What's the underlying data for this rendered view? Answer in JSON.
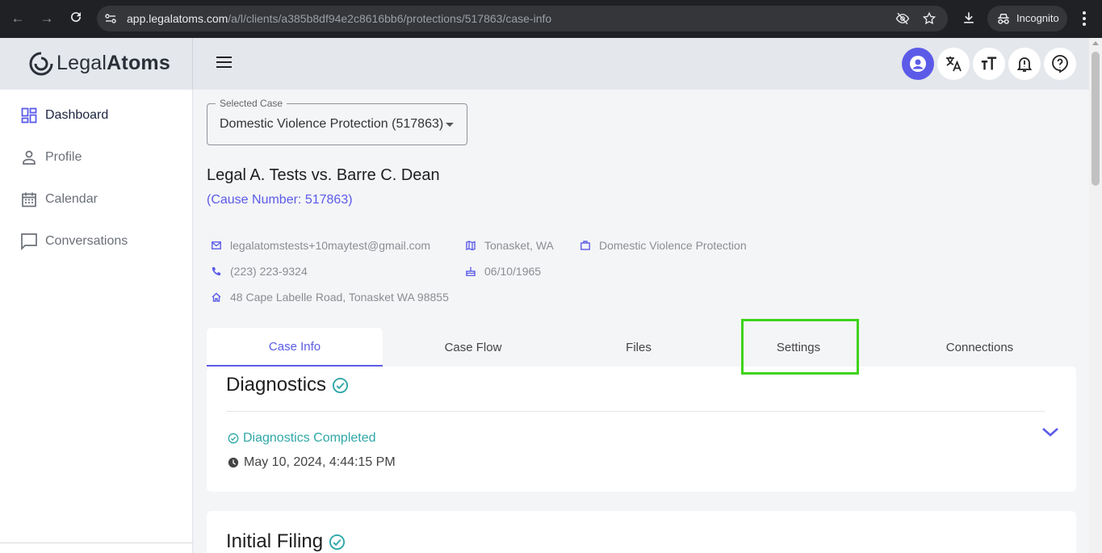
{
  "browser": {
    "url_host": "app.legalatoms.com",
    "url_path": "/a/l/clients/a385b8df94e2c8616bb6/protections/517863/case-info",
    "incognito_label": "Incognito",
    "icons": [
      "back-icon",
      "forward-icon",
      "reload-icon",
      "site-info-icon",
      "eye-off-icon",
      "star-icon",
      "download-icon",
      "incognito-icon",
      "menu-icon"
    ]
  },
  "brand": {
    "name_light": "Legal",
    "name_bold": "Atoms",
    "accent": "#5b5be8"
  },
  "header": {
    "buttons": [
      "account-icon",
      "translate-icon",
      "text-size-icon",
      "notifications-icon",
      "help-icon"
    ]
  },
  "sidebar": {
    "items": [
      {
        "label": "Dashboard",
        "icon": "dashboard-icon",
        "active": true
      },
      {
        "label": "Profile",
        "icon": "person-icon",
        "active": false
      },
      {
        "label": "Calendar",
        "icon": "calendar-icon",
        "active": false
      },
      {
        "label": "Conversations",
        "icon": "chat-icon",
        "active": false
      }
    ]
  },
  "case_select": {
    "label": "Selected Case",
    "value": "Domestic Violence Protection (517863)"
  },
  "case": {
    "title": "Legal A. Tests vs. Barre C. Dean",
    "cause_number": "(Cause Number: 517863)",
    "email": "legalatomstests+10maytest@gmail.com",
    "location": "Tonasket, WA",
    "case_type": "Domestic Violence Protection",
    "phone": "(223) 223-9324",
    "birth_date": "06/10/1965",
    "address": "48 Cape Labelle Road, Tonasket WA 98855"
  },
  "tabs": [
    {
      "label": "Case Info",
      "active": true
    },
    {
      "label": "Case Flow",
      "active": false
    },
    {
      "label": "Files",
      "active": false
    },
    {
      "label": "Settings",
      "active": false
    },
    {
      "label": "Connections",
      "active": false
    }
  ],
  "highlight_color": "#3dd41b",
  "diagnostics": {
    "title": "Diagnostics",
    "status": "Diagnostics Completed",
    "timestamp": "May 10, 2024, 4:44:15 PM",
    "status_color": "#2fa7a7"
  },
  "initial_filing": {
    "title": "Initial Filing"
  }
}
